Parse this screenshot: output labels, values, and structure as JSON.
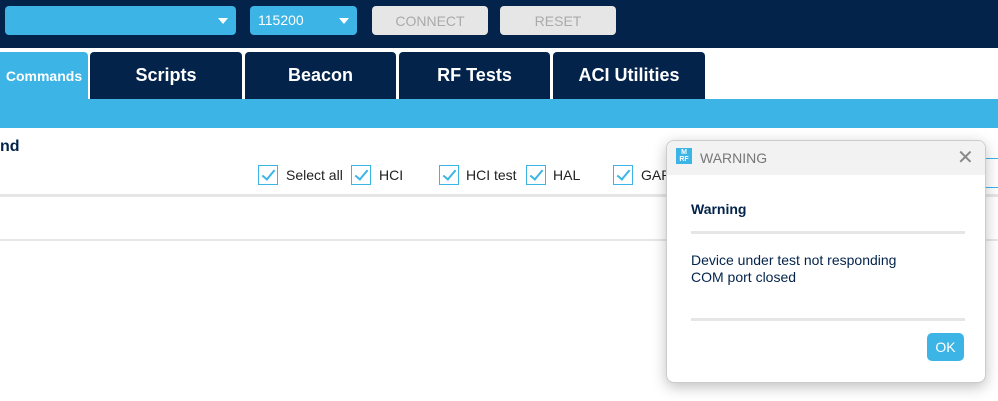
{
  "toolbar": {
    "port_value": "",
    "baud_value": "115200",
    "connect_label": "CONNECT",
    "reset_label": "RESET"
  },
  "tabs": [
    {
      "label": "Commands",
      "active": true
    },
    {
      "label": "Scripts"
    },
    {
      "label": "Beacon"
    },
    {
      "label": "RF Tests"
    },
    {
      "label": "ACI Utilities"
    }
  ],
  "panel": {
    "title_fragment": "nd",
    "filters": [
      {
        "label": "Select all",
        "checked": true
      },
      {
        "label": "HCI",
        "checked": true
      },
      {
        "label": "HCI test",
        "checked": true
      },
      {
        "label": "HAL",
        "checked": true
      },
      {
        "label": "GAP",
        "checked": true
      }
    ]
  },
  "dialog": {
    "title": "WARNING",
    "logo": "MRF",
    "heading": "Warning",
    "message_line1": "Device under test not responding",
    "message_line2": "COM port closed",
    "ok_label": "OK"
  },
  "colors": {
    "navy": "#03234b",
    "accent": "#3cb4e6"
  }
}
